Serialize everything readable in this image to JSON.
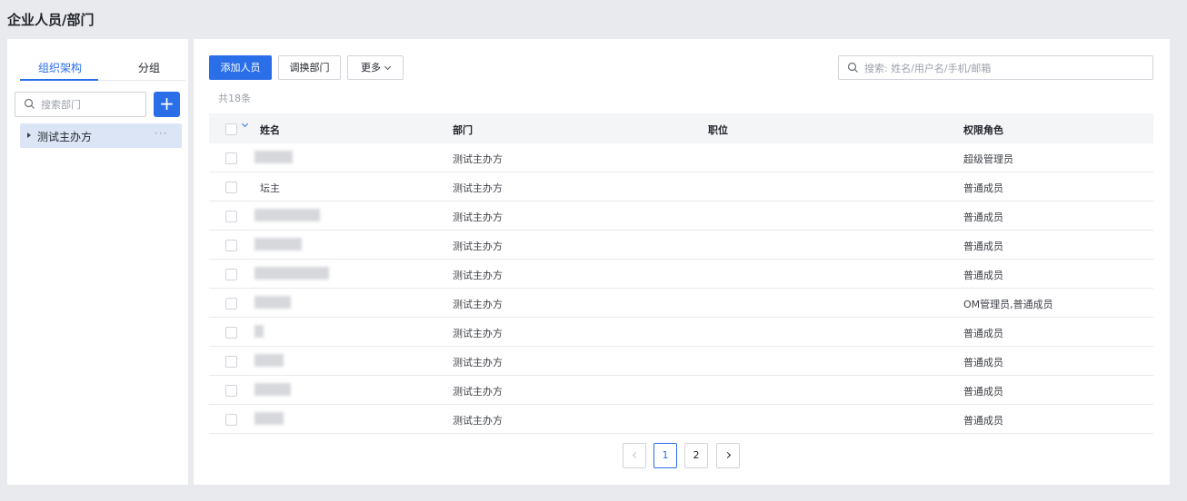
{
  "page": {
    "title": "企业人员/部门"
  },
  "sidebar": {
    "tabs": [
      {
        "label": "组织架构",
        "active": true
      },
      {
        "label": "分组",
        "active": false
      }
    ],
    "search_placeholder": "搜索部门",
    "add_icon": "plus-icon",
    "tree": [
      {
        "label": "测试主办方",
        "more": "···"
      }
    ]
  },
  "toolbar": {
    "add_label": "添加人员",
    "transfer_label": "调换部门",
    "more_label": "更多",
    "search_placeholder": "搜索: 姓名/用户名/手机/邮箱"
  },
  "total_text": "共18条",
  "table": {
    "headers": {
      "name": "姓名",
      "dept": "部门",
      "position": "职位",
      "role": "权限角色"
    },
    "rows": [
      {
        "name": "",
        "dept": "测试主办方",
        "position": "",
        "role": "超级管理员"
      },
      {
        "name": "坛主",
        "dept": "测试主办方",
        "position": "",
        "role": "普通成员"
      },
      {
        "name": "",
        "dept": "测试主办方",
        "position": "",
        "role": "普通成员"
      },
      {
        "name": "",
        "dept": "测试主办方",
        "position": "",
        "role": "普通成员"
      },
      {
        "name": "",
        "dept": "测试主办方",
        "position": "",
        "role": "普通成员"
      },
      {
        "name": "",
        "dept": "测试主办方",
        "position": "",
        "role": "OM管理员,普通成员"
      },
      {
        "name": "",
        "dept": "测试主办方",
        "position": "",
        "role": "普通成员"
      },
      {
        "name": "",
        "dept": "测试主办方",
        "position": "",
        "role": "普通成员"
      },
      {
        "name": "",
        "dept": "测试主办方",
        "position": "",
        "role": "普通成员"
      },
      {
        "name": "",
        "dept": "测试主办方",
        "position": "",
        "role": "普通成员"
      }
    ]
  },
  "pagination": {
    "pages": [
      "1",
      "2"
    ],
    "current": "1"
  },
  "colors": {
    "accent": "#2a6ee8",
    "background": "#e9eaee",
    "selected_node": "#dbe5f6"
  }
}
